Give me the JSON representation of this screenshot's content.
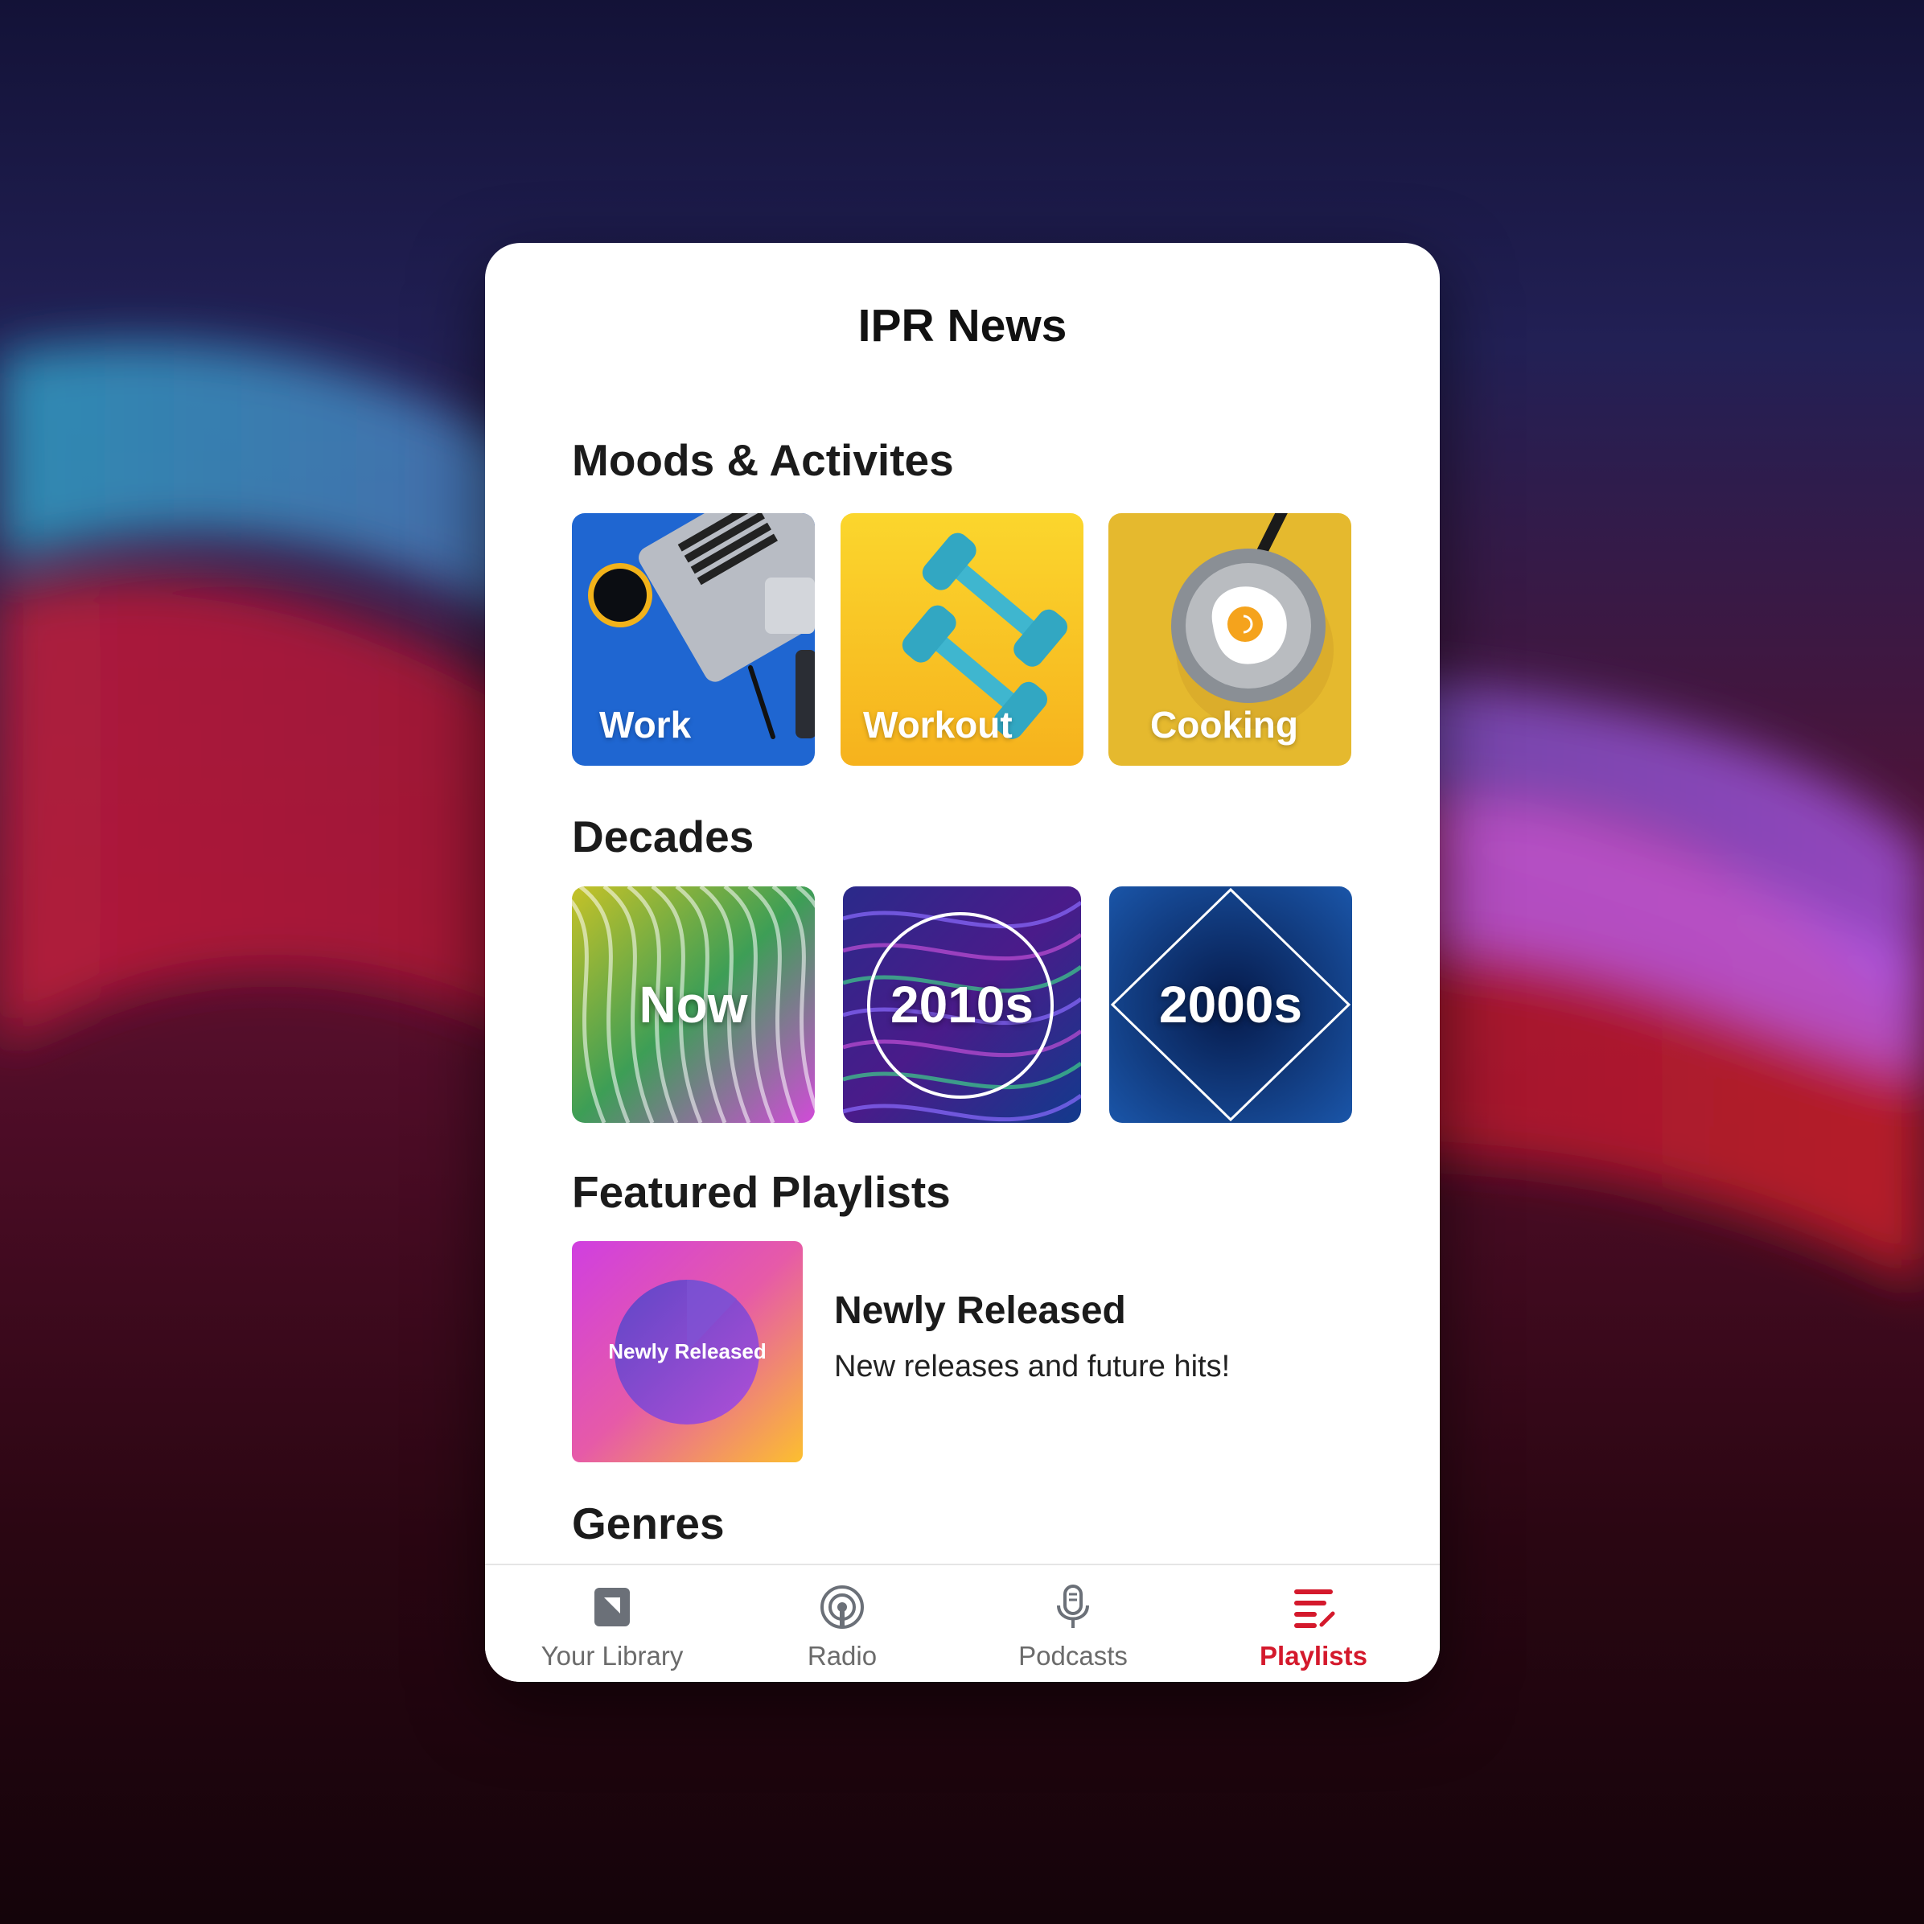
{
  "app": {
    "title": "IPR News"
  },
  "sections": {
    "moods": {
      "title": "Moods & Activites",
      "tiles": [
        {
          "label": "Work",
          "icon": "laptop-coffee-icon",
          "color": "#1f66d1"
        },
        {
          "label": "Workout",
          "icon": "dumbbell-icon",
          "color": "#f7c41f"
        },
        {
          "label": "Cooking",
          "icon": "frying-pan-egg-icon",
          "color": "#e5b92e"
        }
      ]
    },
    "decades": {
      "title": "Decades",
      "tiles": [
        {
          "label": "Now"
        },
        {
          "label": "2010s"
        },
        {
          "label": "2000s"
        }
      ]
    },
    "featured": {
      "title": "Featured Playlists",
      "items": [
        {
          "art_label": "Newly Released",
          "name": "Newly Released",
          "description": "New releases and future hits!"
        }
      ]
    },
    "genres": {
      "title": "Genres"
    }
  },
  "tabs": [
    {
      "label": "Your Library",
      "icon": "library-icon",
      "active": false
    },
    {
      "label": "Radio",
      "icon": "radio-icon",
      "active": false
    },
    {
      "label": "Podcasts",
      "icon": "microphone-icon",
      "active": false
    },
    {
      "label": "Playlists",
      "icon": "playlist-icon",
      "active": true
    }
  ],
  "colors": {
    "accent": "#d4192c",
    "tab_inactive": "#6b6b6b"
  }
}
